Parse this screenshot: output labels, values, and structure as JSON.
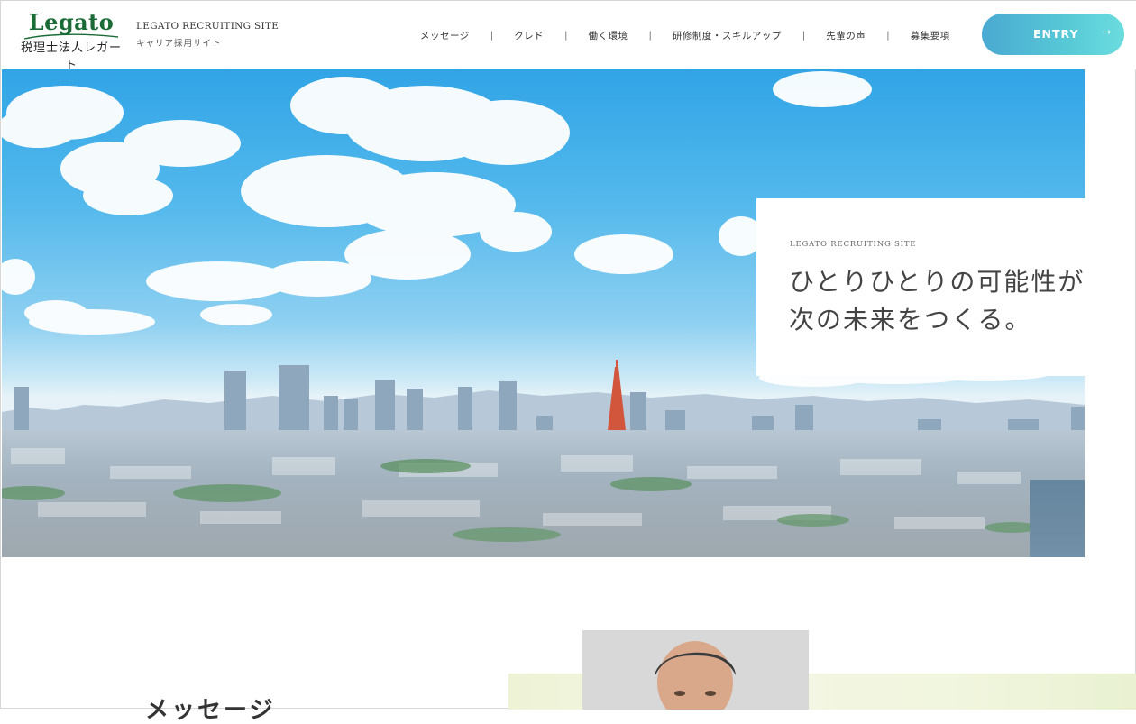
{
  "header": {
    "logo": {
      "wordmark": "Legato",
      "subtitle": "税理士法人レガート"
    },
    "site_title": {
      "en": "LEGATO RECRUITING SITE",
      "ja": "キャリア採用サイト"
    },
    "nav": {
      "items": [
        {
          "label": "メッセージ"
        },
        {
          "label": "クレド"
        },
        {
          "label": "働く環境"
        },
        {
          "label": "研修制度・スキルアップ"
        },
        {
          "label": "先輩の声"
        },
        {
          "label": "募集要項"
        }
      ],
      "separator": "|"
    },
    "entry_button": {
      "label": "ENTRY",
      "arrow": "→"
    }
  },
  "hero": {
    "eyebrow": "LEGATO RECRUITING SITE",
    "catch_line1": "ひとりひとりの可能性が",
    "catch_line2": "次の未来をつくる。",
    "image": "tokyo-skyline-photo"
  },
  "message_section": {
    "heading": "メッセージ",
    "portrait": "representative-portrait-photo"
  },
  "colors": {
    "brand_green": "#1a6b35",
    "entry_gradient_start": "#4aa9d2",
    "entry_gradient_end": "#6bdddf",
    "sky_top": "#31a4e6"
  }
}
